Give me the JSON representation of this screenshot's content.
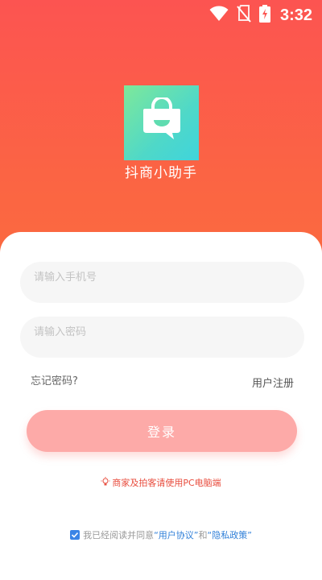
{
  "status_bar": {
    "time": "3:32",
    "icons": [
      "wifi-icon",
      "no-sim-icon",
      "battery-charging-icon"
    ]
  },
  "app": {
    "name": "抖商小助手",
    "logo_icon": "shopping-bag-chat-icon"
  },
  "colors": {
    "hero_top": "#fc5451",
    "hero_bottom": "#fb6a3f",
    "login_button": "#fdaaa8",
    "tip_text": "#e84c3d",
    "link": "#2f7fd8",
    "checkbox": "#3b84e6"
  },
  "form": {
    "phone_placeholder": "请输入手机号",
    "password_placeholder": "请输入密码",
    "forgot_password": "忘记密码?",
    "register": "用户注册",
    "login_button": "登录"
  },
  "tip": {
    "icon": "lightbulb-icon",
    "text": "商家及拍客请使用PC电脑端"
  },
  "agreement": {
    "checked": true,
    "prefix": "我已经阅读并同意",
    "user_agreement": "“用户协议”",
    "and": "和",
    "privacy_policy": "“隐私政策”"
  }
}
